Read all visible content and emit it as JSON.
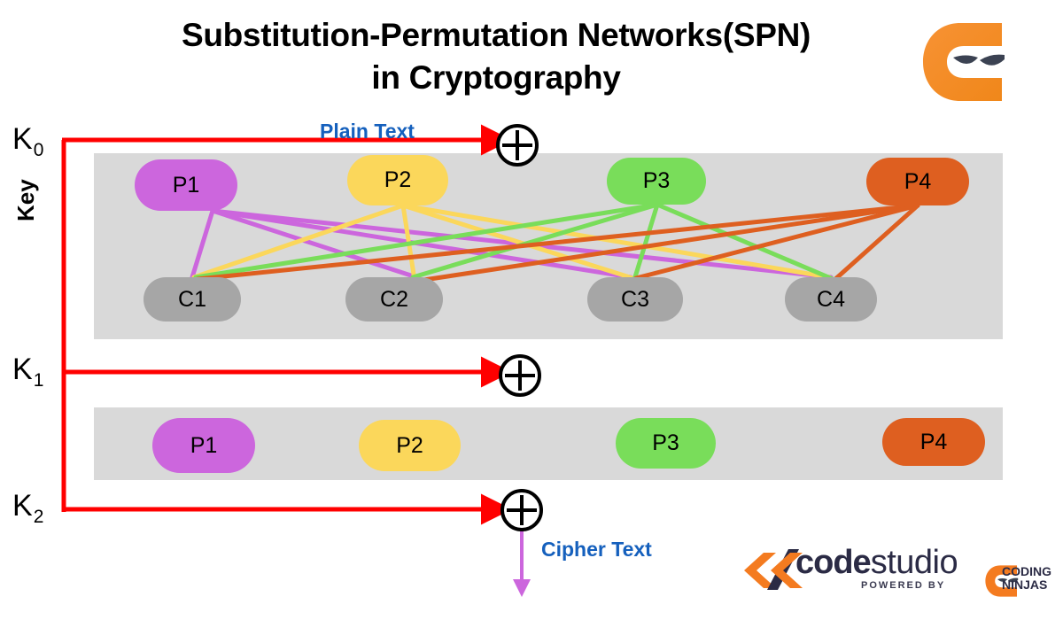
{
  "title": {
    "line1": "Substitution-Permutation Networks(SPN)",
    "line2": "in Cryptography"
  },
  "labels": {
    "plain_text": "Plain Text",
    "cipher_text": "Cipher Text",
    "key_axis": "Key",
    "k0": "K",
    "k0_sub": "0",
    "k1": "K",
    "k1_sub": "1",
    "k2": "K",
    "k2_sub": "2"
  },
  "colors": {
    "p1": "#cc66dd",
    "p2": "#fbd75b",
    "p3": "#79dd5a",
    "p4": "#de5f20",
    "cipher_node": "#a6a6a6",
    "panel": "#d9d9d9",
    "key_arrow": "#ff0000",
    "flow_label": "#1560bd",
    "output_arrow": "#cc66dd",
    "brand_orange": "#f47b20",
    "brand_navy": "#2b2b45"
  },
  "round1": {
    "substitution_nodes": [
      {
        "label": "P1",
        "color_key": "p1"
      },
      {
        "label": "P2",
        "color_key": "p2"
      },
      {
        "label": "P3",
        "color_key": "p3"
      },
      {
        "label": "P4",
        "color_key": "p4"
      }
    ],
    "permutation_nodes": [
      {
        "label": "C1"
      },
      {
        "label": "C2"
      },
      {
        "label": "C3"
      },
      {
        "label": "C4"
      }
    ]
  },
  "round2": {
    "substitution_nodes": [
      {
        "label": "P1",
        "color_key": "p1"
      },
      {
        "label": "P2",
        "color_key": "p2"
      },
      {
        "label": "P3",
        "color_key": "p3"
      },
      {
        "label": "P4",
        "color_key": "p4"
      }
    ]
  },
  "xor_gates": [
    {
      "name": "xor-round-0",
      "glyph": "+"
    },
    {
      "name": "xor-round-1",
      "glyph": "+"
    },
    {
      "name": "xor-round-2",
      "glyph": "+"
    }
  ],
  "branding": {
    "ninja_logo_alt": "coding-ninjas-logo",
    "code": "code",
    "studio": "studio",
    "powered_by": "POWERED BY",
    "coding": "CODING",
    "ninjas": "NINJAS"
  }
}
